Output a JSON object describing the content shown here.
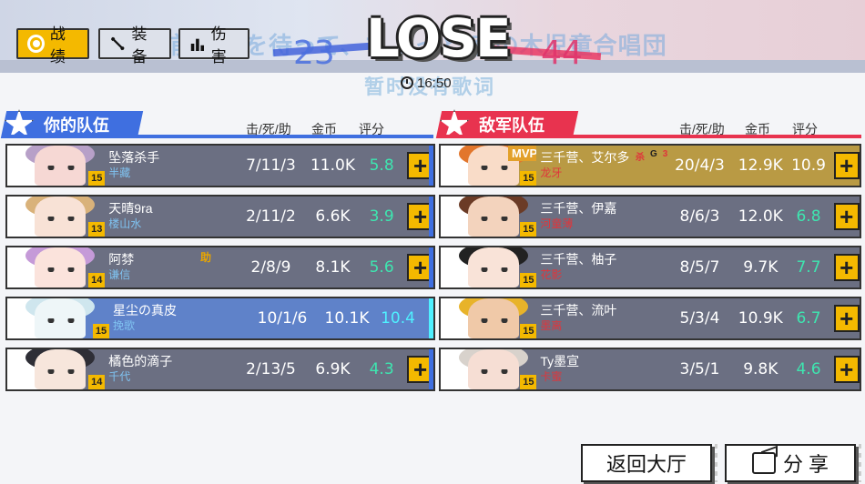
{
  "header": {
    "result": "LOSE",
    "score_left": "23",
    "score_right": "44",
    "time": "16:50",
    "marquee_text": "独前の音を待って、ちょっと 森の木児童合唱団",
    "subtitle_text": "暂时没有歌词"
  },
  "tabs": [
    {
      "label": "战绩",
      "icon": "ring-icon",
      "active": true
    },
    {
      "label": "装备",
      "icon": "tools-icon",
      "active": false
    },
    {
      "label": "伤害",
      "icon": "bar-chart-icon",
      "active": false
    }
  ],
  "columns": {
    "kda": "击/死/助",
    "gold": "金币",
    "rating": "评分"
  },
  "my_team": {
    "title": "你的队伍",
    "color": "#3f6fe0",
    "players": [
      {
        "name": "坠落杀手",
        "hero": "半藏",
        "level": "15",
        "kda": "7/11/3",
        "gold": "11.0K",
        "rating": "5.8"
      },
      {
        "name": "天晴9ra",
        "hero": "楼山水",
        "level": "13",
        "kda": "2/11/2",
        "gold": "6.6K",
        "rating": "3.9"
      },
      {
        "name": "阿棼",
        "hero": "谦信",
        "level": "14",
        "kda": "2/8/9",
        "gold": "8.1K",
        "rating": "5.6",
        "badge": "助"
      },
      {
        "name": "星尘の真皮",
        "hero": "挽歌",
        "level": "15",
        "kda": "10/1/6",
        "gold": "10.1K",
        "rating": "10.4",
        "is_me": true
      },
      {
        "name": "橘色的滴子",
        "hero": "千代",
        "level": "14",
        "kda": "2/13/5",
        "gold": "6.9K",
        "rating": "4.3"
      }
    ]
  },
  "enemy_team": {
    "title": "敌军队伍",
    "color": "#e8334f",
    "players": [
      {
        "name": "三千营、艾尔多",
        "hero": "龙牙",
        "level": "15",
        "kda": "20/4/3",
        "gold": "12.9K",
        "rating": "10.9",
        "mvp": "MVP",
        "badges": [
          "杀",
          "G",
          "3"
        ]
      },
      {
        "name": "三千营、伊嘉",
        "hero": "河童薄",
        "level": "15",
        "kda": "8/6/3",
        "gold": "12.0K",
        "rating": "6.8"
      },
      {
        "name": "三千营、柚子",
        "hero": "花影",
        "level": "15",
        "kda": "8/5/7",
        "gold": "9.7K",
        "rating": "7.7"
      },
      {
        "name": "三千营、流叶",
        "hero": "墨离",
        "level": "15",
        "kda": "5/3/4",
        "gold": "10.9K",
        "rating": "6.7"
      },
      {
        "name": "Ty墨宣",
        "hero": "卡蜜",
        "level": "15",
        "kda": "3/5/1",
        "gold": "9.8K",
        "rating": "4.6"
      }
    ]
  },
  "buttons": {
    "back_lobby": "返回大厅",
    "share": "分 享",
    "add_friend": "+"
  },
  "colors": {
    "accent": "#f4b900",
    "rating_green": "#3ee6b0",
    "row_dark": "#6b6f82",
    "row_me": "#5f82c9",
    "row_mvp": "#b99a44"
  }
}
